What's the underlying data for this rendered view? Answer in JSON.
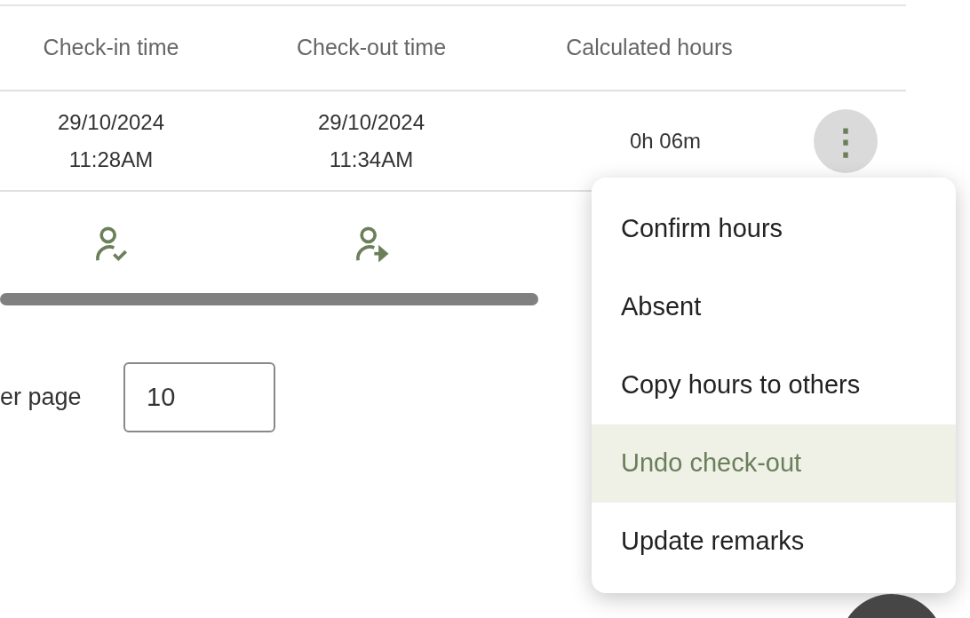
{
  "table": {
    "columns": [
      "Check-in time",
      "Check-out time",
      "Calculated hours"
    ],
    "rows": [
      {
        "check_in": [
          "29/10/2024",
          "11:28AM"
        ],
        "check_out": [
          "29/10/2024",
          "11:34AM"
        ],
        "hours": "0h 06m",
        "menu_button": "⋮"
      }
    ],
    "icon_row": [
      {
        "kind": "check-in"
      },
      {
        "kind": "check-out"
      }
    ]
  },
  "pagination": {
    "label": "er page",
    "rows_per_page": "10"
  },
  "menu": {
    "items": [
      {
        "label": "Confirm hours",
        "selected": false
      },
      {
        "label": "Absent",
        "selected": false
      },
      {
        "label": "Copy hours to others",
        "selected": false
      },
      {
        "label": "Undo check-out",
        "selected": true
      },
      {
        "label": "Update remarks",
        "selected": false
      }
    ]
  }
}
